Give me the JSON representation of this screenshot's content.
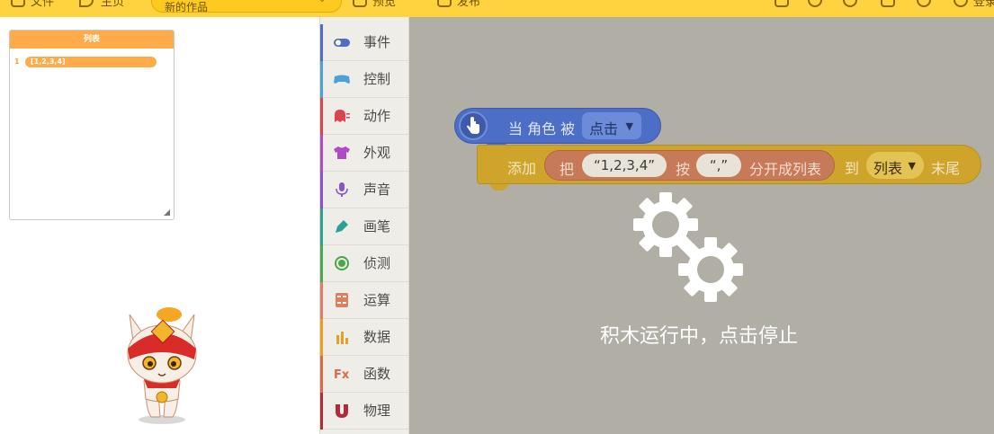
{
  "toolbar": {
    "file_label": "文件",
    "share_label": "主页",
    "search_placeholder": "新的作品",
    "preview_label": "预览",
    "publish_label": "发布",
    "login_label": "登录"
  },
  "stage": {
    "list_monitor": {
      "title": "列表",
      "rows": [
        {
          "index": "1",
          "value": "[1,2,3,4]"
        }
      ]
    }
  },
  "categories": [
    {
      "label": "事件",
      "icon": "toggle-icon",
      "color": "#4c6ec6"
    },
    {
      "label": "控制",
      "icon": "gamepad-icon",
      "color": "#4aa2d9"
    },
    {
      "label": "动作",
      "icon": "ghost-icon",
      "color": "#d8474f"
    },
    {
      "label": "外观",
      "icon": "shirt-icon",
      "color": "#b04bc5"
    },
    {
      "label": "声音",
      "icon": "microphone-icon",
      "color": "#8a52d0"
    },
    {
      "label": "画笔",
      "icon": "pen-icon",
      "color": "#2aa096"
    },
    {
      "label": "侦测",
      "icon": "radar-icon",
      "color": "#4aa848"
    },
    {
      "label": "运算",
      "icon": "calculator-icon",
      "color": "#e07f5e"
    },
    {
      "label": "数据",
      "icon": "bar-chart-icon",
      "color": "#e9a021"
    },
    {
      "label": "函数",
      "icon": "function-icon",
      "color": "#d96a4a"
    },
    {
      "label": "物理",
      "icon": "magnet-icon",
      "color": "#b22b3a"
    }
  ],
  "workspace": {
    "hat_block": {
      "text": "当 角色 被",
      "dropdown": "点击"
    },
    "statement_block": {
      "add_label": "添加",
      "split_label_1": "把",
      "split_string": "“1,2,3,4”",
      "split_label_2": "按",
      "split_delim": "“,”",
      "split_label_3": "分开成列表",
      "to_label": "到",
      "list_dropdown": "列表",
      "end_label": "末尾"
    },
    "running_message": "积木运行中，点击停止"
  }
}
